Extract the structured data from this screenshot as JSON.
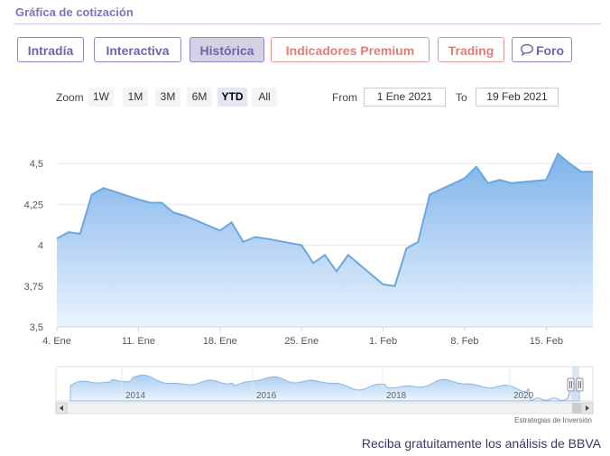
{
  "header": {
    "title": "Gráfica de cotización"
  },
  "tabs": [
    {
      "label": "Intradía",
      "style": "purple"
    },
    {
      "label": "Interactiva",
      "style": "purple"
    },
    {
      "label": "Histórica",
      "style": "active"
    },
    {
      "label": "Indicadores Premium",
      "style": "red"
    },
    {
      "label": "Trading",
      "style": "red"
    },
    {
      "label": "Foro",
      "style": "purple",
      "icon": "chat-bubble-icon"
    }
  ],
  "zoom": {
    "label": "Zoom",
    "buttons": [
      "1W",
      "1M",
      "3M",
      "6M",
      "YTD",
      "All"
    ],
    "selected": "YTD"
  },
  "range": {
    "from_label": "From",
    "from_value": "1 Ene 2021",
    "to_label": "To",
    "to_value": "19 Feb 2021"
  },
  "colors": {
    "accent": "#7b74b8",
    "line": "#6aa7e0",
    "area_top": "#7eb3ea",
    "area_bottom": "#eaf3fc",
    "warning": "#e07d78"
  },
  "chart_data": {
    "type": "area",
    "title": "",
    "xlabel": "",
    "ylabel": "",
    "ylim": [
      3.5,
      4.6
    ],
    "yticks": [
      3.5,
      3.75,
      4,
      4.25,
      4.5
    ],
    "ytick_labels": [
      "3,5",
      "3,75",
      "4",
      "4,25",
      "4,5"
    ],
    "xtick_labels": [
      "4. Ene",
      "11. Ene",
      "18. Ene",
      "25. Ene",
      "1. Feb",
      "8. Feb",
      "15. Feb"
    ],
    "grid": true,
    "x": [
      "2021-01-04",
      "2021-01-05",
      "2021-01-06",
      "2021-01-07",
      "2021-01-08",
      "2021-01-11",
      "2021-01-12",
      "2021-01-13",
      "2021-01-14",
      "2021-01-15",
      "2021-01-18",
      "2021-01-19",
      "2021-01-20",
      "2021-01-21",
      "2021-01-22",
      "2021-01-25",
      "2021-01-26",
      "2021-01-27",
      "2021-01-28",
      "2021-01-29",
      "2021-02-01",
      "2021-02-02",
      "2021-02-03",
      "2021-02-04",
      "2021-02-05",
      "2021-02-08",
      "2021-02-09",
      "2021-02-10",
      "2021-02-11",
      "2021-02-12",
      "2021-02-15",
      "2021-02-16",
      "2021-02-17",
      "2021-02-18",
      "2021-02-19"
    ],
    "values": [
      4.04,
      4.08,
      4.07,
      4.31,
      4.35,
      4.28,
      4.26,
      4.26,
      4.2,
      4.18,
      4.09,
      4.14,
      4.02,
      4.05,
      4.04,
      4.0,
      3.89,
      3.94,
      3.84,
      3.94,
      3.76,
      3.75,
      3.98,
      4.02,
      4.31,
      4.41,
      4.48,
      4.38,
      4.4,
      4.38,
      4.4,
      4.56,
      4.5,
      4.45,
      4.45
    ]
  },
  "navigator": {
    "year_labels": [
      "2014",
      "2016",
      "2018",
      "2020"
    ]
  },
  "credit": "Estrategias de Inversión",
  "promo": "Reciba gratuitamente los análisis de BBVA"
}
